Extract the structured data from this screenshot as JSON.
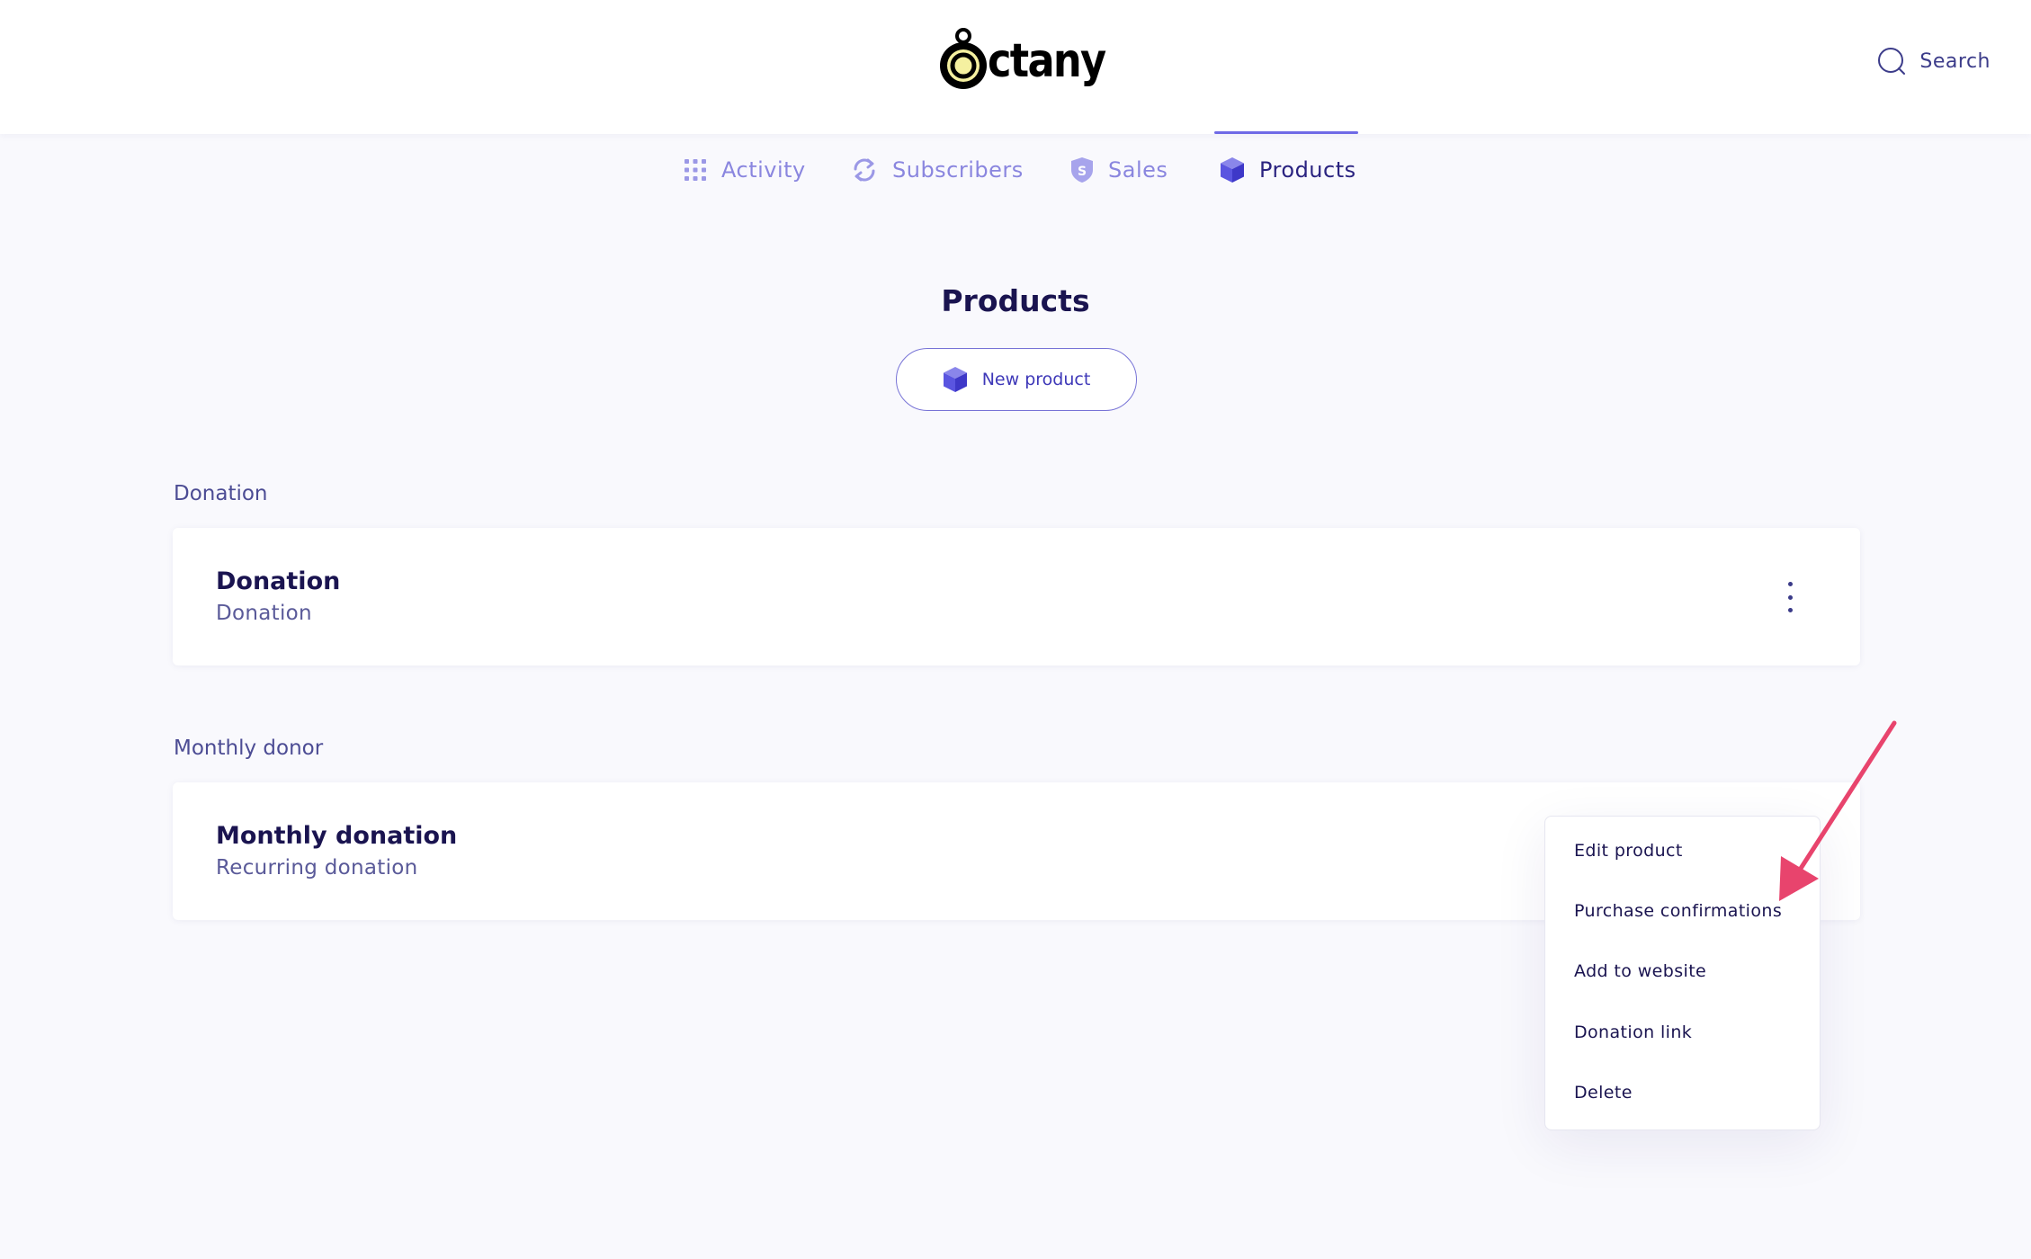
{
  "header": {
    "logo_text": "ctany",
    "search_label": "Search"
  },
  "nav": {
    "tabs": [
      {
        "label": "Activity",
        "icon": "grid-dots-icon",
        "active": false
      },
      {
        "label": "Subscribers",
        "icon": "refresh-icon",
        "active": false
      },
      {
        "label": "Sales",
        "icon": "shield-dollar-icon",
        "active": false
      },
      {
        "label": "Products",
        "icon": "cube-icon",
        "active": true
      }
    ]
  },
  "main": {
    "title": "Products",
    "new_product_label": "New product",
    "groups": [
      {
        "label": "Donation",
        "product": {
          "name": "Donation",
          "subtitle": "Donation"
        }
      },
      {
        "label": "Monthly donor",
        "product": {
          "name": "Monthly donation",
          "subtitle": "Recurring donation"
        }
      }
    ]
  },
  "context_menu": {
    "items": [
      "Edit product",
      "Purchase confirmations",
      "Add to website",
      "Donation link",
      "Delete"
    ]
  },
  "colors": {
    "accent": "#5a55e0",
    "annotation_arrow": "#e8446d",
    "text_dark": "#1a1450"
  }
}
